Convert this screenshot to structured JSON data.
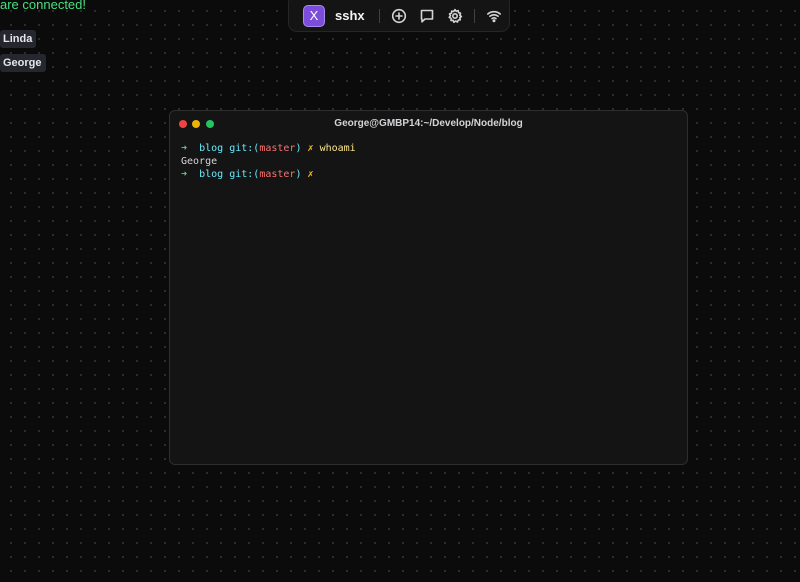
{
  "status": {
    "message": "are connected!"
  },
  "users": [
    {
      "name": "Linda"
    },
    {
      "name": "George"
    }
  ],
  "toolbar": {
    "logo_text": "X",
    "app_name": "sshx",
    "icons": [
      "plus-circle-icon",
      "chat-icon",
      "gear-icon",
      "wifi-icon"
    ]
  },
  "terminal": {
    "title": "George@GMBP14:~/Develop/Node/blog",
    "lines": [
      {
        "arrow": "➜",
        "dir": "blog",
        "git_open": "git:(",
        "branch": "master",
        "git_close": ")",
        "dirty": "✗",
        "command": "whoami"
      },
      {
        "output": "George"
      },
      {
        "arrow": "➜",
        "dir": "blog",
        "git_open": "git:(",
        "branch": "master",
        "git_close": ")",
        "dirty": "✗",
        "command": ""
      }
    ]
  },
  "colors": {
    "accent": "#7c4ddb",
    "status_green": "#4ade80",
    "background": "#0b0b0b"
  }
}
